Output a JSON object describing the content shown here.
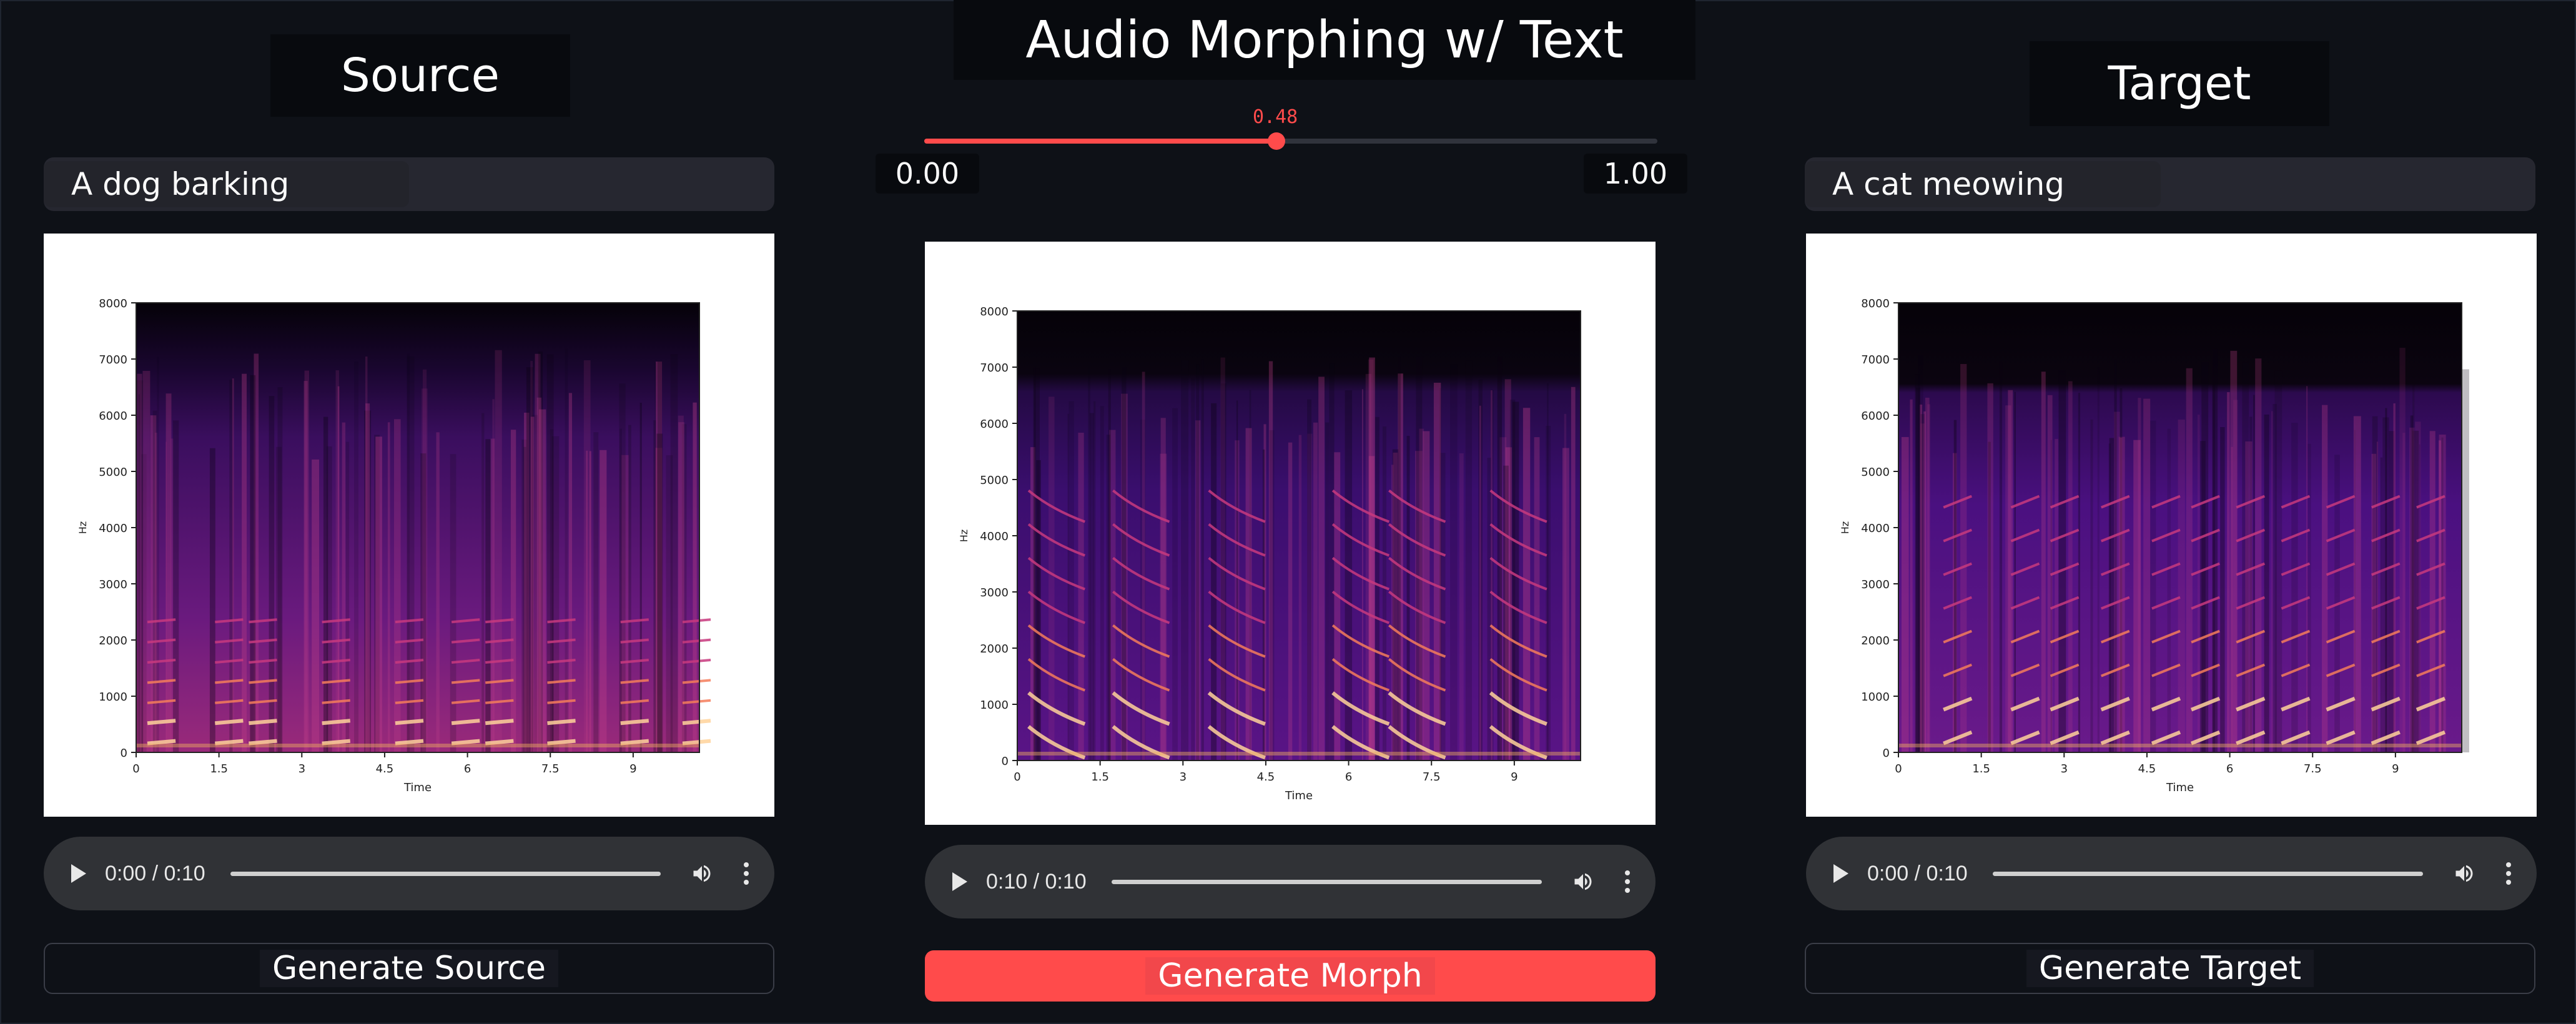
{
  "app": {
    "title": "Audio Morphing w/ Text"
  },
  "columns": {
    "source": {
      "title": "Source",
      "prompt": "A dog barking",
      "audio_time": "0:00 / 0:10",
      "button_label": "Generate Source"
    },
    "morph": {
      "slider_value": "0.48",
      "slider_fraction": 0.48,
      "slider_min": "0.00",
      "slider_max": "1.00",
      "audio_time": "0:10 / 0:10",
      "button_label": "Generate Morph"
    },
    "target": {
      "title": "Target",
      "prompt": "A cat meowing",
      "audio_time": "0:00 / 0:10",
      "button_label": "Generate Target"
    }
  },
  "spectrogram": {
    "ylabel": "Hz",
    "xlabel": "Time",
    "y_ticks": [
      "0",
      "1000",
      "2000",
      "3000",
      "4000",
      "5000",
      "6000",
      "7000",
      "8000"
    ],
    "x_ticks": [
      "0",
      "1.5",
      "3",
      "4.5",
      "6",
      "7.5",
      "9"
    ]
  },
  "colors": {
    "accent": "#ff4b4b",
    "background": "#0e1117",
    "input_bg": "#262730",
    "audio_bg": "#303236"
  },
  "icons": {
    "play": "play-icon",
    "volume": "volume-icon",
    "more": "more-vertical-icon"
  }
}
